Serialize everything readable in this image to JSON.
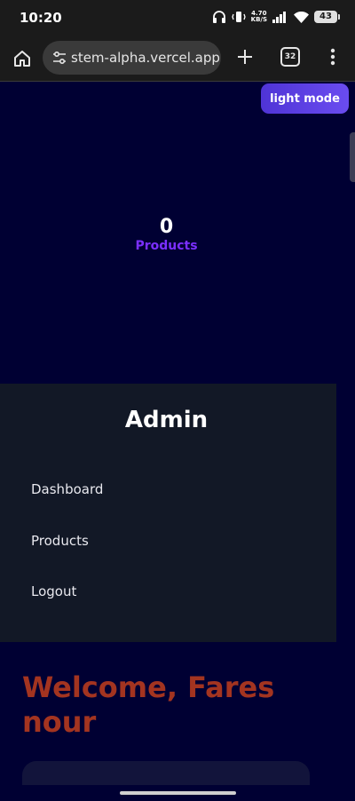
{
  "status_bar": {
    "time": "10:20",
    "net_speed_value": "4.70",
    "net_speed_unit": "KB/S",
    "battery": "43"
  },
  "browser": {
    "url": "stem-alpha.vercel.app",
    "tab_count": "32"
  },
  "theme_toggle": {
    "label": "light mode"
  },
  "stats": {
    "value": "0",
    "label": "Products"
  },
  "sidebar": {
    "title": "Admin",
    "items": [
      {
        "label": "Dashboard"
      },
      {
        "label": "Products"
      },
      {
        "label": "Logout"
      }
    ]
  },
  "welcome": {
    "text": "Welcome, Fares nour"
  },
  "colors": {
    "page_bg": "#000033",
    "sidebar_bg": "#121826",
    "accent_purple": "#7b2fff",
    "welcome_red": "#a33420",
    "toggle_bg": "#5a3fe3"
  }
}
